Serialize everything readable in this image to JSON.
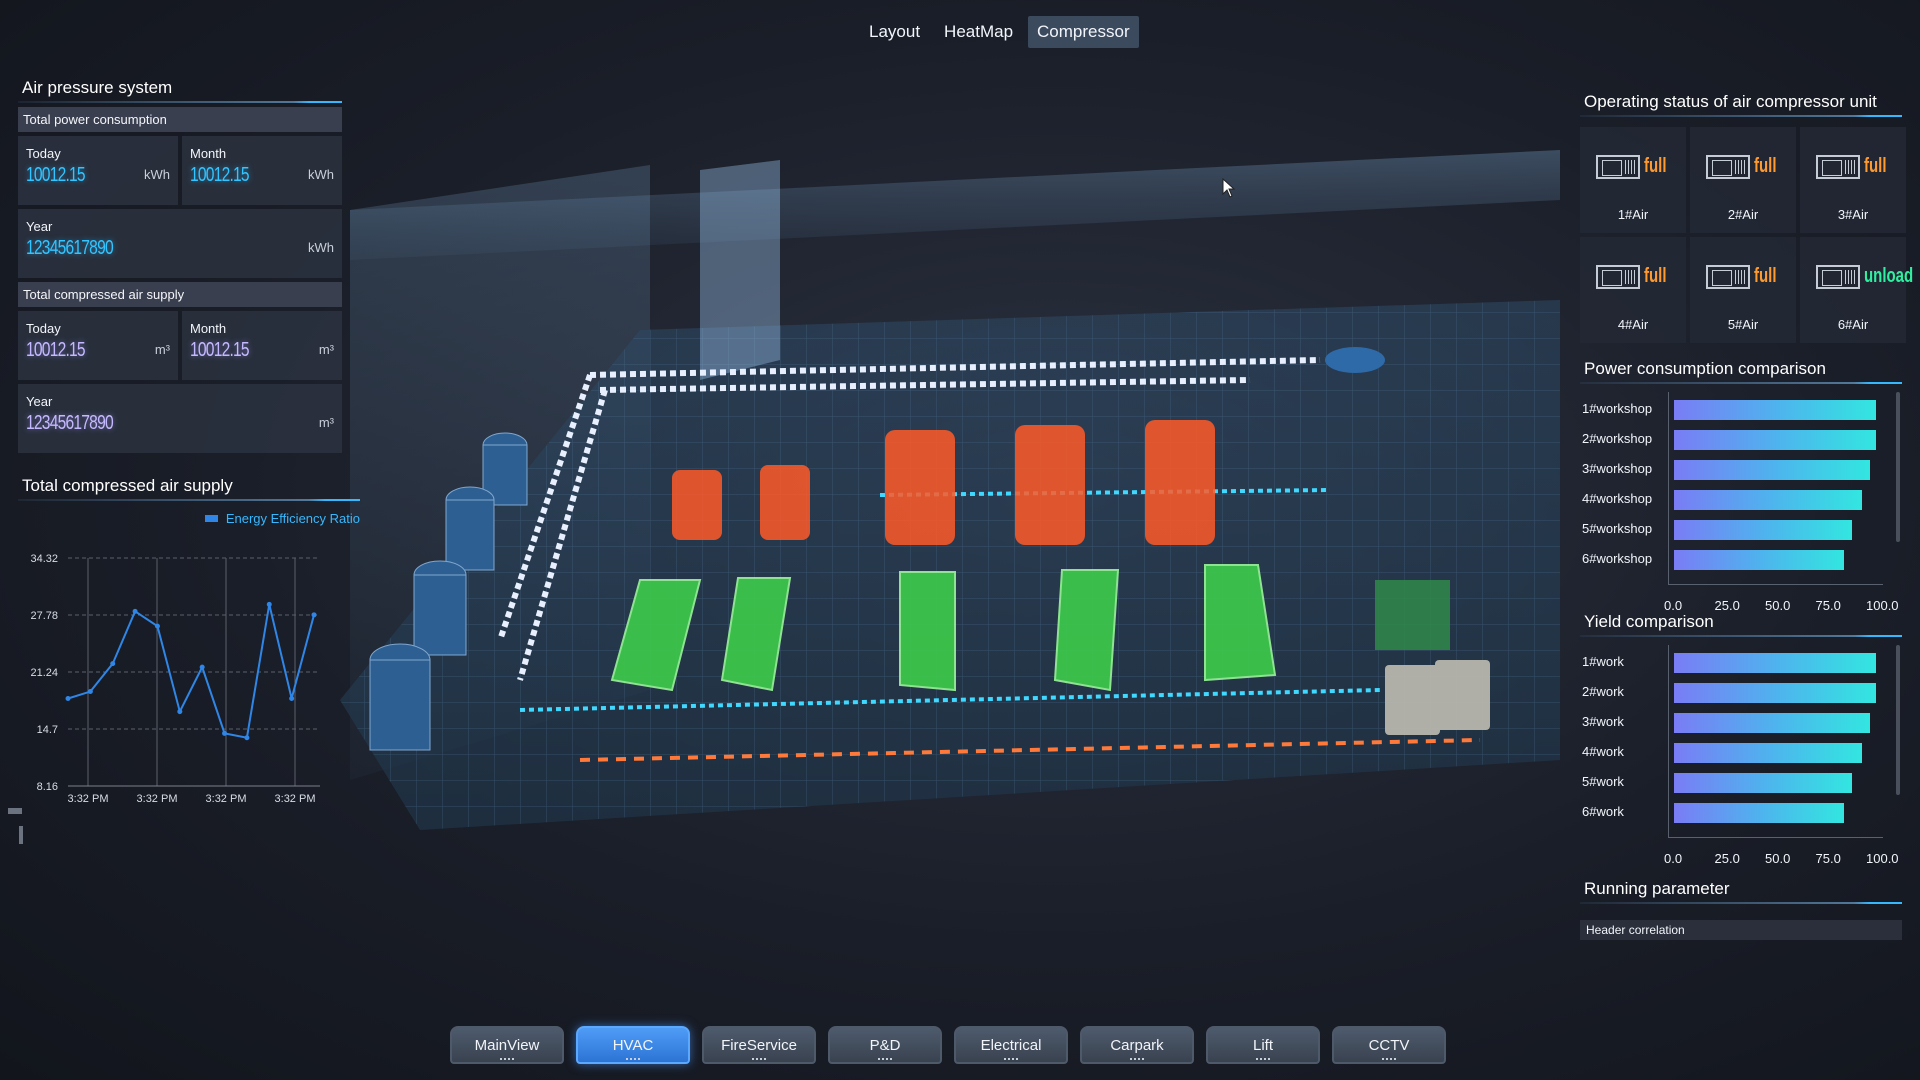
{
  "top_tabs": [
    "Layout",
    "HeatMap",
    "Compressor"
  ],
  "active_top_tab": "Compressor",
  "left": {
    "title": "Air pressure system",
    "power": {
      "header": "Total power consumption",
      "today_label": "Today",
      "today_value": "10012.15",
      "today_unit": "kWh",
      "month_label": "Month",
      "month_value": "10012.15",
      "month_unit": "kWh",
      "year_label": "Year",
      "year_value": "12345617890",
      "year_unit": "kWh"
    },
    "air": {
      "header": "Total compressed air supply",
      "today_label": "Today",
      "today_value": "10012.15",
      "today_unit": "m³",
      "month_label": "Month",
      "month_value": "10012.15",
      "month_unit": "m³",
      "year_label": "Year",
      "year_value": "12345617890",
      "year_unit": "m³"
    },
    "chart_title": "Total compressed air supply"
  },
  "right": {
    "status_title": "Operating status of air compressor unit",
    "units": [
      {
        "name": "1#Air",
        "state": "full"
      },
      {
        "name": "2#Air",
        "state": "full"
      },
      {
        "name": "3#Air",
        "state": "full"
      },
      {
        "name": "4#Air",
        "state": "full"
      },
      {
        "name": "5#Air",
        "state": "full"
      },
      {
        "name": "6#Air",
        "state": "unload"
      }
    ],
    "power_title": "Power consumption comparison",
    "yield_title": "Yield comparison",
    "param_title": "Running parameter",
    "param_header": "Header correlation"
  },
  "bottom_nav": [
    "MainView",
    "HVAC",
    "FireService",
    "P&D",
    "Electrical",
    "Carpark",
    "Lift",
    "CCTV"
  ],
  "active_bottom_nav": "HVAC",
  "colors": {
    "accent": "#36b8ff",
    "full": "#ff9a2e",
    "unload": "#2ff0a0",
    "line": "#2f86e6"
  },
  "chart_data": [
    {
      "type": "line",
      "title": "Total compressed air supply",
      "legend": [
        "Energy Efficiency Ratio"
      ],
      "y_ticks": [
        "34.32",
        "27.78",
        "21.24",
        "14.7",
        "8.16"
      ],
      "x_ticks": [
        "3:32 PM",
        "3:32 PM",
        "3:32 PM",
        "3:32 PM"
      ],
      "ylim": [
        8.16,
        34.32
      ],
      "series": [
        {
          "name": "Energy Efficiency Ratio",
          "values": [
            18.2,
            19.0,
            22.2,
            28.2,
            26.5,
            16.7,
            21.8,
            14.2,
            13.7,
            29.0,
            18.2,
            27.8
          ]
        }
      ]
    },
    {
      "type": "bar",
      "title": "Power consumption comparison",
      "categories": [
        "1#workshop",
        "2#workshop",
        "3#workshop",
        "4#workshop",
        "5#workshop",
        "6#workshop"
      ],
      "values": [
        100,
        100,
        97,
        93,
        88,
        84
      ],
      "x_ticks": [
        "0.0",
        "25.0",
        "50.0",
        "75.0",
        "100.0"
      ],
      "xlim": [
        0,
        100
      ]
    },
    {
      "type": "bar",
      "title": "Yield comparison",
      "categories": [
        "1#work",
        "2#work",
        "3#work",
        "4#work",
        "5#work",
        "6#work"
      ],
      "values": [
        100,
        100,
        97,
        93,
        88,
        84
      ],
      "x_ticks": [
        "0.0",
        "25.0",
        "50.0",
        "75.0",
        "100.0"
      ],
      "xlim": [
        0,
        100
      ]
    }
  ]
}
